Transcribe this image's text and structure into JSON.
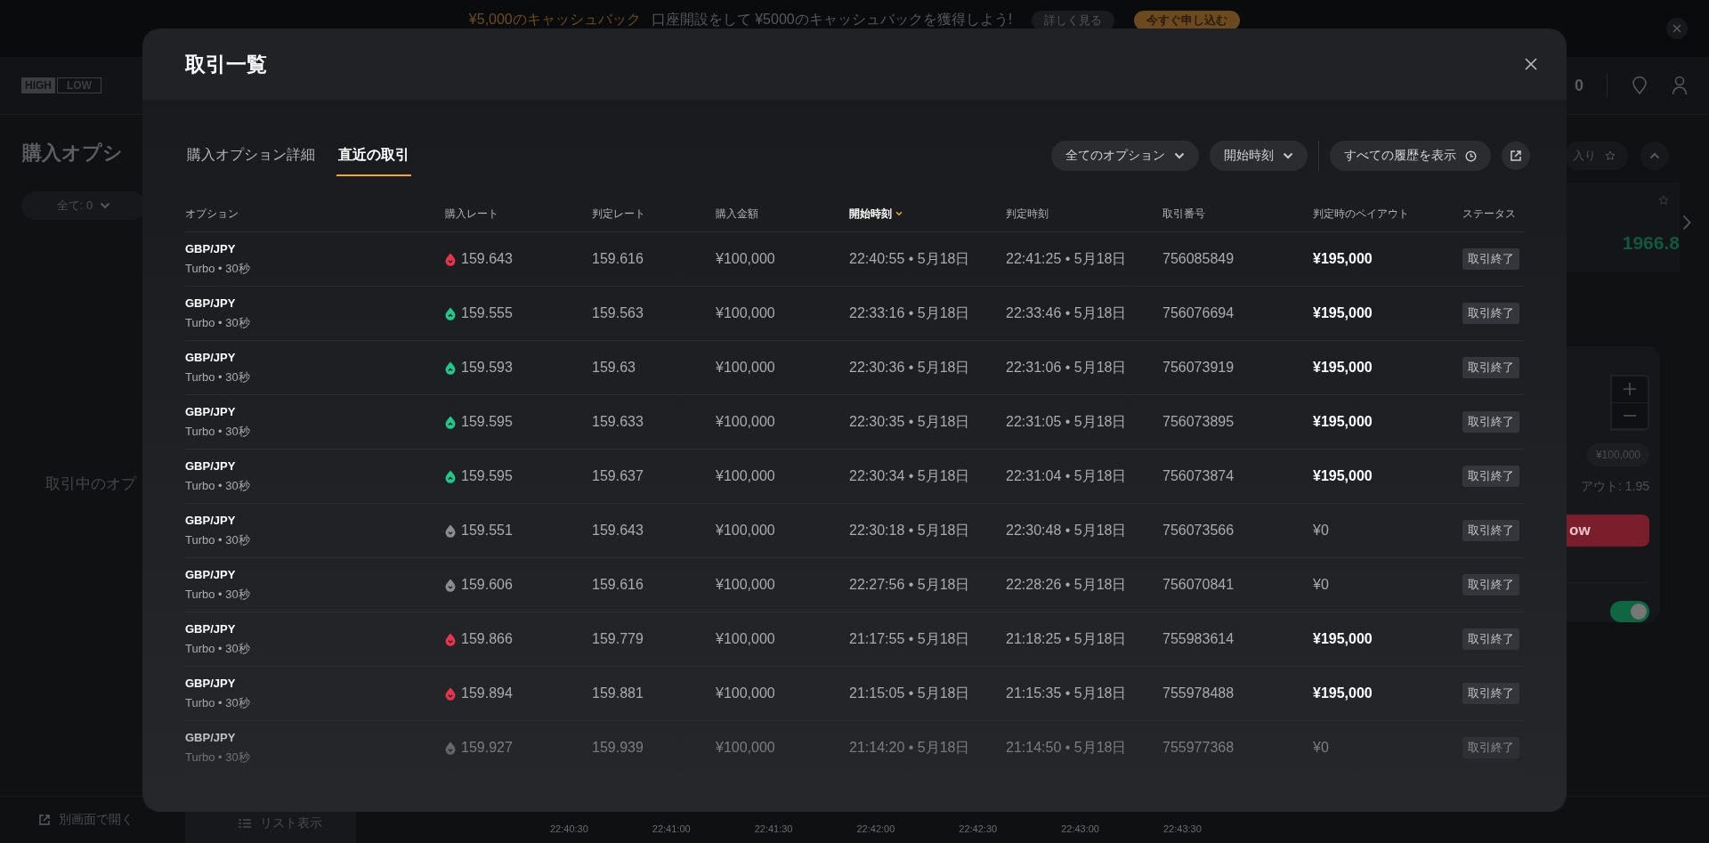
{
  "banner": {
    "headline": "¥5,000のキャッシュバック",
    "text": "口座開設をして ¥5000のキャッシュバックを獲得しよう!",
    "details_button": "詳しく見る",
    "apply_button": "今すぐ申し込む"
  },
  "header": {
    "logo_top": "HIGH",
    "logo_bottom": "LOW",
    "balance": "0"
  },
  "left_panel": {
    "title": "購入オプシ",
    "filter": "全て: 0",
    "empty_message": "取引中のオプ"
  },
  "right_panel": {
    "favorites": "入り",
    "price": "1966.8",
    "amount": "¥100,000",
    "payout": "アウト: 1.95",
    "low_button": "ow",
    "toggle_on": true
  },
  "bottom_bar": {
    "open_window": "別画面で開く",
    "list_view": "リスト表示",
    "time_labels": [
      "22:40:30",
      "22:41:00",
      "22:41:30",
      "22:42:00",
      "22:42:30",
      "22:43:00",
      "22:43:30"
    ]
  },
  "modal": {
    "title": "取引一覧",
    "tabs": [
      {
        "label": "購入オプション詳細",
        "selected": false
      },
      {
        "label": "直近の取引",
        "selected": true
      }
    ],
    "filters": [
      "全てのオプション",
      "開始時刻"
    ],
    "history_button": "すべての履歴を表示",
    "columns": [
      {
        "label": "オプション",
        "sorted": false
      },
      {
        "label": "購入レート",
        "sorted": false
      },
      {
        "label": "判定レート",
        "sorted": false
      },
      {
        "label": "購入金額",
        "sorted": false
      },
      {
        "label": "開始時刻",
        "sorted": true
      },
      {
        "label": "判定時刻",
        "sorted": false
      },
      {
        "label": "取引番号",
        "sorted": false
      },
      {
        "label": "判定時のペイアウト",
        "sorted": false
      },
      {
        "label": "ステータス",
        "sorted": false
      }
    ],
    "rows": [
      {
        "asset": "GBP/JPY",
        "type": "Turbo • 30秒",
        "kind": "down",
        "won": true,
        "rate": "159.643",
        "closing_rate": "159.616",
        "amount": "¥100,000",
        "start": "22:40:55 • 5月18日",
        "end": "22:41:25 • 5月18日",
        "id": "756085849",
        "payout": "¥195,000",
        "status": "取引終了"
      },
      {
        "asset": "GBP/JPY",
        "type": "Turbo • 30秒",
        "kind": "up",
        "won": true,
        "rate": "159.555",
        "closing_rate": "159.563",
        "amount": "¥100,000",
        "start": "22:33:16 • 5月18日",
        "end": "22:33:46 • 5月18日",
        "id": "756076694",
        "payout": "¥195,000",
        "status": "取引終了"
      },
      {
        "asset": "GBP/JPY",
        "type": "Turbo • 30秒",
        "kind": "up",
        "won": true,
        "rate": "159.593",
        "closing_rate": "159.63",
        "amount": "¥100,000",
        "start": "22:30:36 • 5月18日",
        "end": "22:31:06 • 5月18日",
        "id": "756073919",
        "payout": "¥195,000",
        "status": "取引終了"
      },
      {
        "asset": "GBP/JPY",
        "type": "Turbo • 30秒",
        "kind": "up",
        "won": true,
        "rate": "159.595",
        "closing_rate": "159.633",
        "amount": "¥100,000",
        "start": "22:30:35 • 5月18日",
        "end": "22:31:05 • 5月18日",
        "id": "756073895",
        "payout": "¥195,000",
        "status": "取引終了"
      },
      {
        "asset": "GBP/JPY",
        "type": "Turbo • 30秒",
        "kind": "up",
        "won": true,
        "rate": "159.595",
        "closing_rate": "159.637",
        "amount": "¥100,000",
        "start": "22:30:34 • 5月18日",
        "end": "22:31:04 • 5月18日",
        "id": "756073874",
        "payout": "¥195,000",
        "status": "取引終了"
      },
      {
        "asset": "GBP/JPY",
        "type": "Turbo • 30秒",
        "kind": "down",
        "won": false,
        "rate": "159.551",
        "closing_rate": "159.643",
        "amount": "¥100,000",
        "start": "22:30:18 • 5月18日",
        "end": "22:30:48 • 5月18日",
        "id": "756073566",
        "payout": "¥0",
        "status": "取引終了"
      },
      {
        "asset": "GBP/JPY",
        "type": "Turbo • 30秒",
        "kind": "down",
        "won": false,
        "rate": "159.606",
        "closing_rate": "159.616",
        "amount": "¥100,000",
        "start": "22:27:56 • 5月18日",
        "end": "22:28:26 • 5月18日",
        "id": "756070841",
        "payout": "¥0",
        "status": "取引終了"
      },
      {
        "asset": "GBP/JPY",
        "type": "Turbo • 30秒",
        "kind": "down",
        "won": true,
        "rate": "159.866",
        "closing_rate": "159.779",
        "amount": "¥100,000",
        "start": "21:17:55 • 5月18日",
        "end": "21:18:25 • 5月18日",
        "id": "755983614",
        "payout": "¥195,000",
        "status": "取引終了"
      },
      {
        "asset": "GBP/JPY",
        "type": "Turbo • 30秒",
        "kind": "down",
        "won": true,
        "rate": "159.894",
        "closing_rate": "159.881",
        "amount": "¥100,000",
        "start": "21:15:05 • 5月18日",
        "end": "21:15:35 • 5月18日",
        "id": "755978488",
        "payout": "¥195,000",
        "status": "取引終了"
      },
      {
        "asset": "GBP/JPY",
        "type": "Turbo • 30秒",
        "kind": "down",
        "won": false,
        "rate": "159.927",
        "closing_rate": "159.939",
        "amount": "¥100,000",
        "start": "21:14:20 • 5月18日",
        "end": "21:14:50 • 5月18日",
        "id": "755977368",
        "payout": "¥0",
        "status": "取引終了"
      }
    ]
  }
}
